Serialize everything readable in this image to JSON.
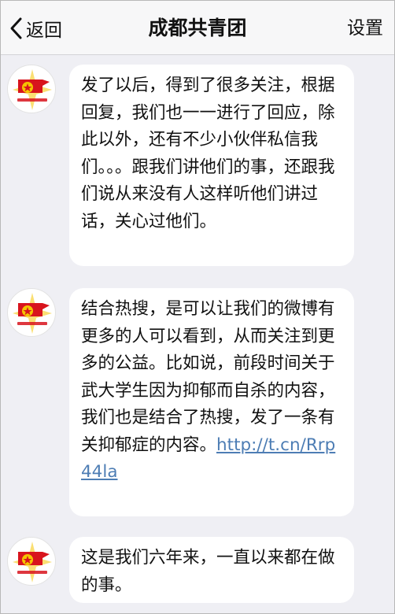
{
  "navbar": {
    "back_label": "返回",
    "title": "成都共青团",
    "settings_label": "设置"
  },
  "messages": [
    {
      "text": "发了以后，得到了很多关注，根据回复，我们也一一进行了回应，除此以外，还有不少小伙伴私信我们。。。跟我们讲他们的事，还跟我们说从来没有人这样听他们讲过话，关心过他们。"
    },
    {
      "text": "结合热搜，是可以让我们的微博有更多的人可以看到，从而关注到更多的公益。比如说，前段时间关于武大学生因为抑郁而自杀的内容，我们也是结合了热搜，发了一条有关抑郁症的内容。",
      "link": "http://t.cn/Rrp44la"
    },
    {
      "text": "这是我们六年来，一直以来都在做的事。"
    }
  ],
  "colors": {
    "background": "#efeff4",
    "link": "#4d7db4",
    "avatar_red": "#d8141d",
    "avatar_yellow": "#f5c400"
  },
  "icons": {
    "back": "chevron-left-icon",
    "avatar": "communist-youth-league-emblem"
  }
}
